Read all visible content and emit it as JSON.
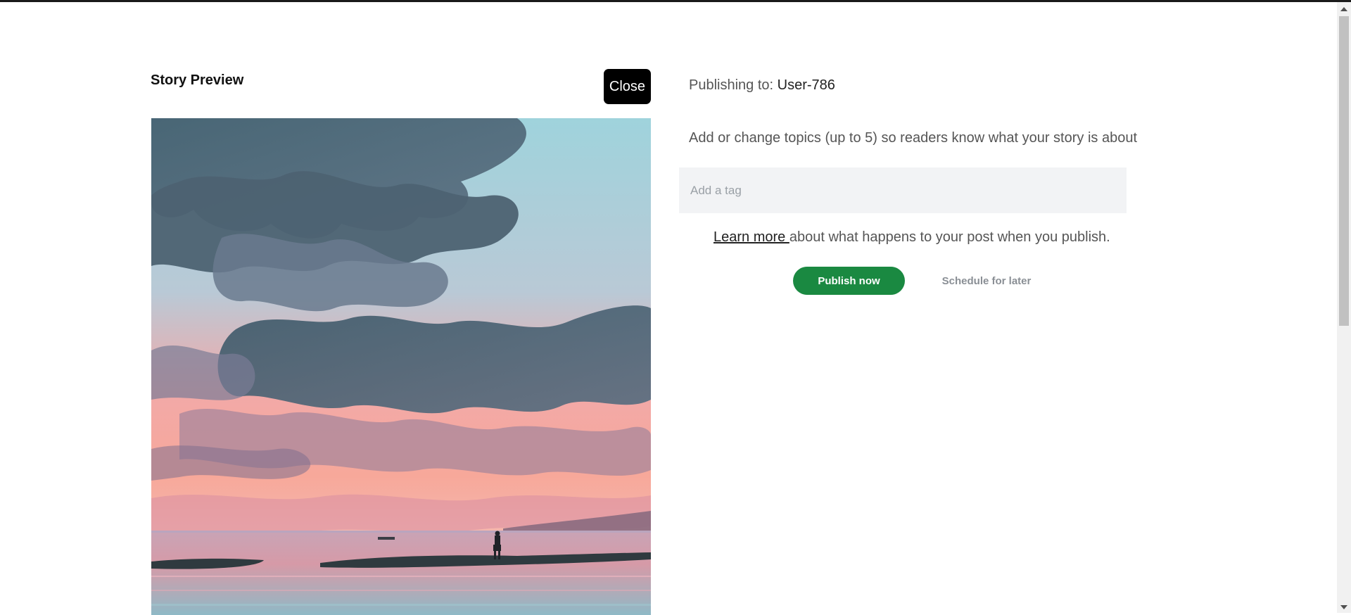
{
  "preview": {
    "heading": "Story Preview",
    "close_label": "Close",
    "image_description_icon": "cover-image"
  },
  "publish": {
    "publishing_to_label": "Publishing to:",
    "publishing_to_user": "User-786",
    "topics_help": "Add or change topics (up to 5) so readers know what your story is about",
    "tag_placeholder": "Add a tag",
    "tag_value": "",
    "learn_more_link": "Learn more ",
    "learn_more_rest": "about what happens to your post when you publish.",
    "publish_now_label": "Publish now",
    "schedule_label": "Schedule for later"
  },
  "colors": {
    "publish_button": "#1a8941",
    "close_button": "#000000",
    "tag_field_bg": "#f2f3f5"
  }
}
